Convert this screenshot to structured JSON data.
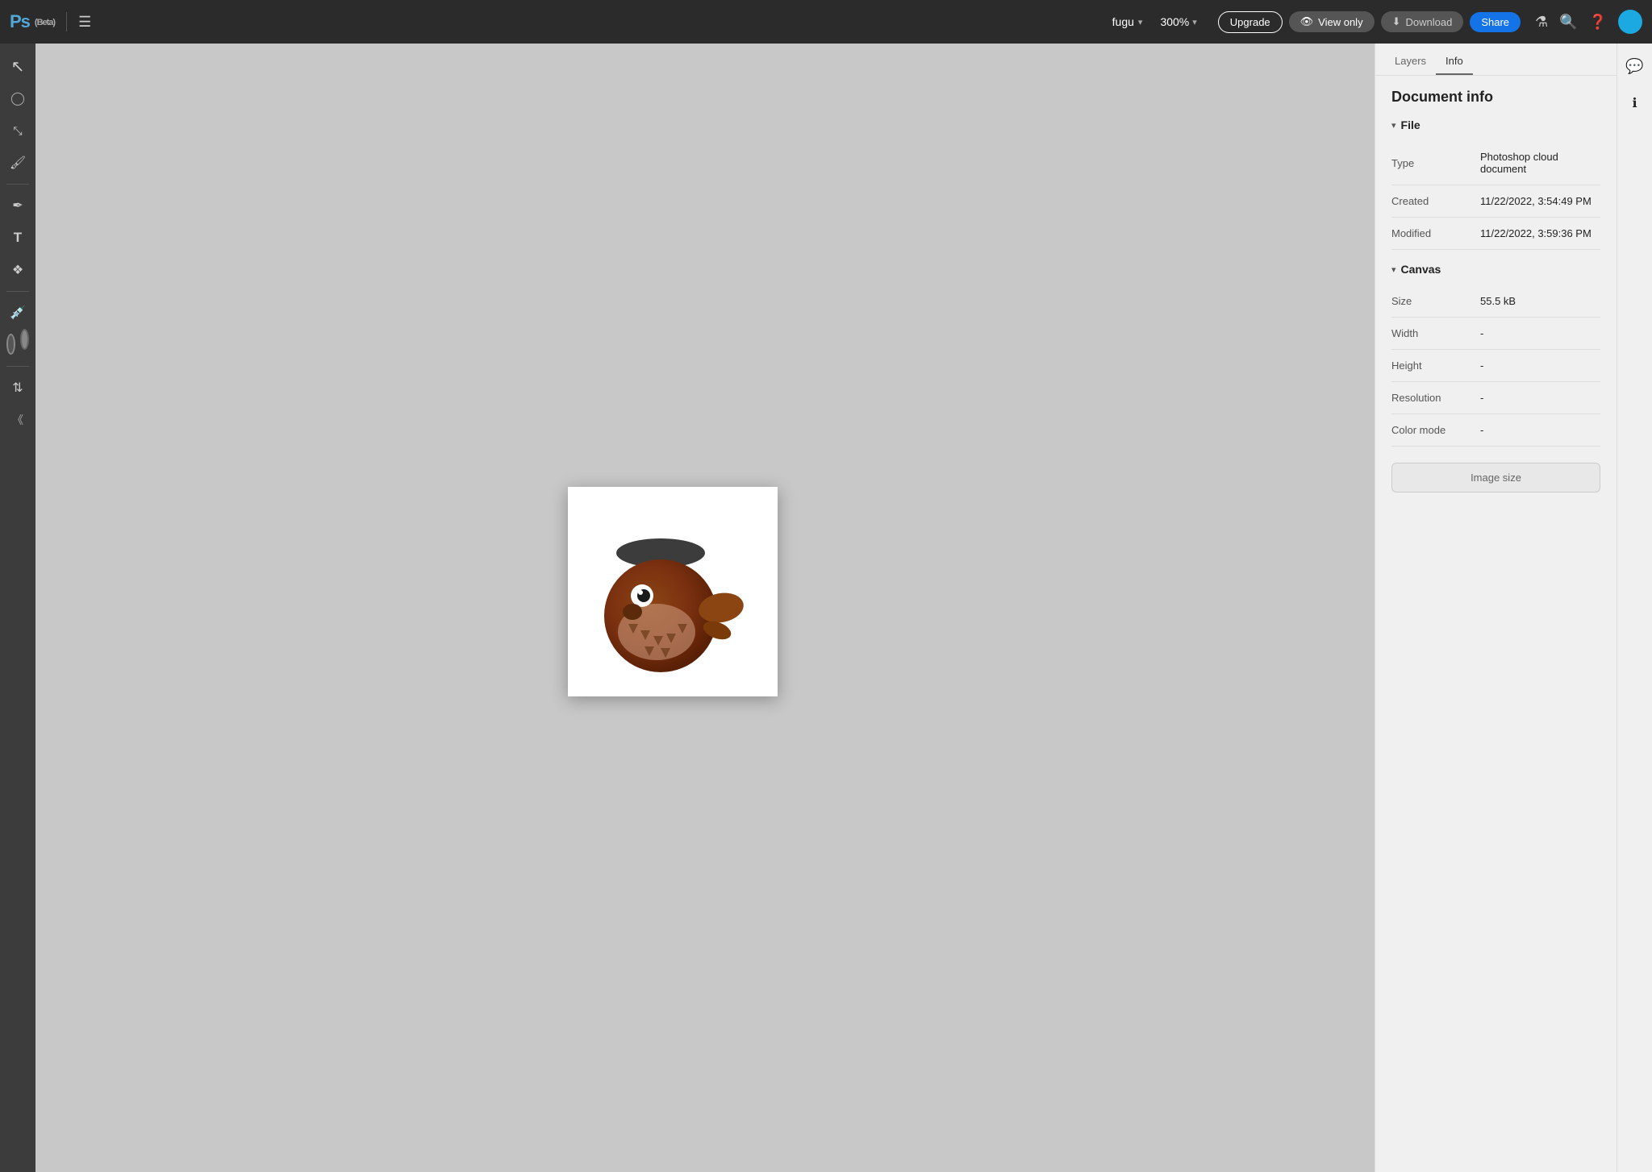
{
  "app": {
    "name": "Ps",
    "beta_label": "(Beta)",
    "filename": "fugu",
    "zoom": "300%",
    "upgrade_label": "Upgrade",
    "viewonly_label": "View only",
    "download_label": "Download",
    "share_label": "Share"
  },
  "toolbar": {
    "tools": [
      {
        "name": "select-tool",
        "icon": "↖",
        "label": "Select"
      },
      {
        "name": "lasso-tool",
        "icon": "⬤",
        "label": "Lasso"
      },
      {
        "name": "transform-tool",
        "icon": "⤢",
        "label": "Transform"
      },
      {
        "name": "brush-tool",
        "icon": "✏",
        "label": "Brush"
      },
      {
        "name": "pen-tool",
        "icon": "✒",
        "label": "Pen"
      },
      {
        "name": "text-tool",
        "icon": "T",
        "label": "Text"
      },
      {
        "name": "shape-tool",
        "icon": "❖",
        "label": "Shape"
      },
      {
        "name": "eyedropper-tool",
        "icon": "⌀",
        "label": "Eyedropper"
      }
    ]
  },
  "panel": {
    "tabs": [
      {
        "id": "tab-layers",
        "label": "Layers"
      },
      {
        "id": "tab-info",
        "label": "Info",
        "active": true
      }
    ],
    "title": "Document info",
    "sections": {
      "file": {
        "label": "File",
        "collapsed": false,
        "rows": [
          {
            "label": "Type",
            "value": "Photoshop cloud document"
          },
          {
            "label": "Created",
            "value": "11/22/2022, 3:54:49 PM"
          },
          {
            "label": "Modified",
            "value": "11/22/2022, 3:59:36 PM"
          }
        ]
      },
      "canvas": {
        "label": "Canvas",
        "collapsed": false,
        "rows": [
          {
            "label": "Size",
            "value": "55.5 kB"
          },
          {
            "label": "Width",
            "value": "-"
          },
          {
            "label": "Height",
            "value": "-"
          },
          {
            "label": "Resolution",
            "value": "-"
          },
          {
            "label": "Color mode",
            "value": "-"
          }
        ]
      }
    },
    "image_size_button": "Image size"
  },
  "far_right": {
    "icons": [
      {
        "name": "comment-icon",
        "icon": "💬"
      },
      {
        "name": "info-icon",
        "icon": "ℹ",
        "active": true
      }
    ]
  }
}
